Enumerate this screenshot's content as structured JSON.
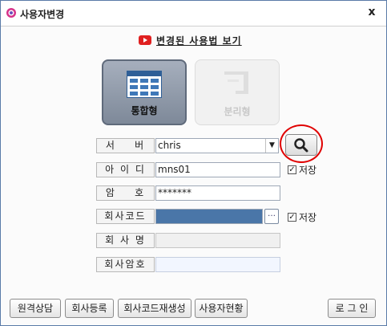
{
  "window": {
    "title": "사용자변경",
    "close_label": "x"
  },
  "guide": {
    "label": "변경된 사용법 보기",
    "icon": "youtube-play-icon"
  },
  "modes": [
    {
      "label": "통합형",
      "icon": "integrated-grid-icon",
      "selected": true
    },
    {
      "label": "분리형",
      "icon": "separated-layout-icon",
      "selected": false
    }
  ],
  "form": {
    "server": {
      "label": "서    버",
      "value": "chris"
    },
    "user_id": {
      "label": "아 이 디",
      "value": "mns01"
    },
    "password": {
      "label": "암    호",
      "value": "*******"
    },
    "company_code": {
      "label": "회사코드",
      "value": ""
    },
    "company_name": {
      "label": "회 사 명",
      "value": ""
    },
    "company_password": {
      "label": "회사암호",
      "value": ""
    },
    "save_id": {
      "label": "저장",
      "checked": true
    },
    "save_code": {
      "label": "저장",
      "checked": true
    }
  },
  "buttons": {
    "remote": "원격상담",
    "register": "회사등록",
    "regen_code": "회사코드재생성",
    "user_status": "사용자현황",
    "login": "로 그 인"
  },
  "colors": {
    "selected_field": "#4a76a8",
    "annotation": "#e00000",
    "guide_icon": "#e02020"
  }
}
